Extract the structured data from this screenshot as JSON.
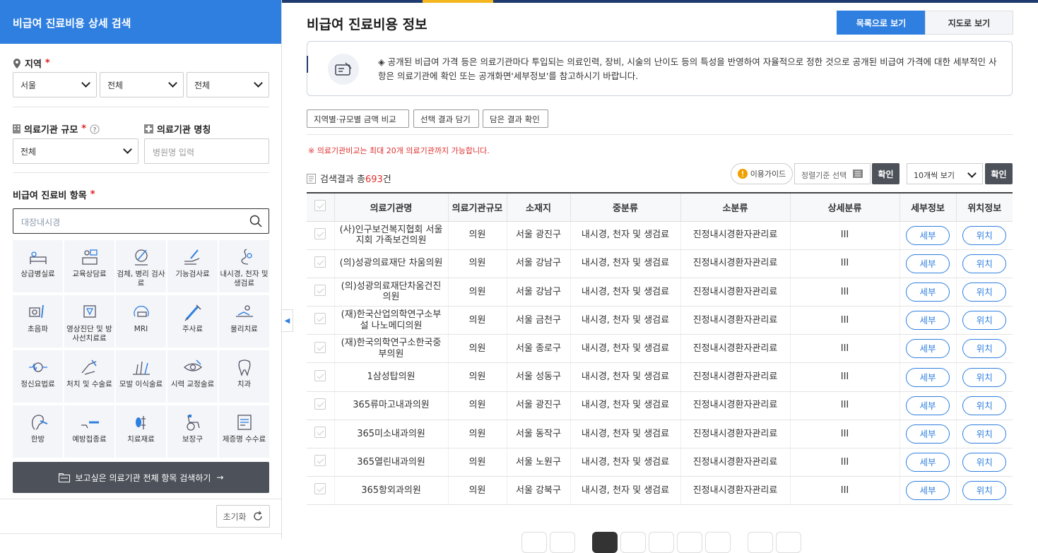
{
  "sidebar": {
    "title": "비급여 진료비용 상세 검색",
    "region_label": "지역",
    "required_mark": "*",
    "region_selects": [
      "서울",
      "전체",
      "전체"
    ],
    "scale_label": "의료기관 규모",
    "scale_select": "전체",
    "name_label": "의료기관 명칭",
    "name_placeholder": "병원명 입력",
    "items_label": "비급여 진료비 항목",
    "search_value": "대장내시경",
    "categories": [
      {
        "label": "상급병실료",
        "icon": "bed-icon"
      },
      {
        "label": "교육상담료",
        "icon": "consult-icon"
      },
      {
        "label": "검체, 병리 검사료",
        "icon": "microscope-icon"
      },
      {
        "label": "기능검사료",
        "icon": "hand-test-icon"
      },
      {
        "label": "내시경, 천자 및 생검료",
        "icon": "endoscope-icon"
      },
      {
        "label": "초음파",
        "icon": "ultrasound-icon"
      },
      {
        "label": "영상진단 및 방사선치료료",
        "icon": "scan-icon"
      },
      {
        "label": "MRI",
        "icon": "mri-icon"
      },
      {
        "label": "주사료",
        "icon": "syringe-icon"
      },
      {
        "label": "물리치료",
        "icon": "therapy-icon"
      },
      {
        "label": "정신요법료",
        "icon": "brain-icon"
      },
      {
        "label": "처치 및 수술료",
        "icon": "surgery-icon"
      },
      {
        "label": "모발 이식술료",
        "icon": "hair-icon"
      },
      {
        "label": "시력 교정술료",
        "icon": "eye-icon"
      },
      {
        "label": "치과",
        "icon": "tooth-icon"
      },
      {
        "label": "한방",
        "icon": "ear-acupuncture-icon"
      },
      {
        "label": "예방접종료",
        "icon": "vaccine-icon"
      },
      {
        "label": "치료재료",
        "icon": "material-icon"
      },
      {
        "label": "보장구",
        "icon": "wheelchair-icon"
      },
      {
        "label": "제증명 수수료",
        "icon": "certificate-icon"
      }
    ],
    "search_all_button": "보고싶은 의료기관 전체 항목 검색하기",
    "reset_button": "초기화"
  },
  "main": {
    "title": "비급여 진료비용 정보",
    "view_list": "목록으로 보기",
    "view_map": "지도로 보기",
    "notice": "◈ 공개된 비급여 가격 등은 의료기관마다 투입되는 의료인력, 장비, 시술의 난이도 등의 특성을 반영하여 자율적으로 정한 것으로 공개된 비급여 가격에 대한 세부적인 사항은 의료기관에 확인 또는 공개화면'세부정보'를 참고하시기 바랍니다.",
    "compare_button": "지역별·규모별 금액 비교",
    "select_button": "선택 결과 담기",
    "saved_button": "담은 결과 확인",
    "warning": "※ 의료기관비교는 최대 20개 의료기관까지 가능합니다.",
    "result_prefix": "검색결과 총",
    "result_count": "693",
    "result_suffix": "건",
    "guide_button": "이용가이드",
    "sort_select": "정렬기준 선택",
    "confirm_button": "확인",
    "page_size_select": "10개씩 보기",
    "columns": [
      "의료기관명",
      "의료기관규모",
      "소재지",
      "중분류",
      "소분류",
      "상세분류",
      "세부정보",
      "위치정보"
    ],
    "detail_label": "세부",
    "location_label": "위치",
    "rows": [
      {
        "name": "(사)인구보건복지협회 서울지회 가족보건의원",
        "scale": "의원",
        "loc": "서울 광진구",
        "mid": "내시경, 천자 및 생검료",
        "sub": "진정내시경환자관리료",
        "detail": "III"
      },
      {
        "name": "(의)성광의료재단 차움의원",
        "scale": "의원",
        "loc": "서울 강남구",
        "mid": "내시경, 천자 및 생검료",
        "sub": "진정내시경환자관리료",
        "detail": "III"
      },
      {
        "name": "(의)성광의료재단차움건진의원",
        "scale": "의원",
        "loc": "서울 강남구",
        "mid": "내시경, 천자 및 생검료",
        "sub": "진정내시경환자관리료",
        "detail": "III"
      },
      {
        "name": "(재)한국산업의학연구소부설 나노메디의원",
        "scale": "의원",
        "loc": "서울 금천구",
        "mid": "내시경, 천자 및 생검료",
        "sub": "진정내시경환자관리료",
        "detail": "III"
      },
      {
        "name": "(재)한국의학연구소한국중부의원",
        "scale": "의원",
        "loc": "서울 종로구",
        "mid": "내시경, 천자 및 생검료",
        "sub": "진정내시경환자관리료",
        "detail": "III"
      },
      {
        "name": "1삼성탑의원",
        "scale": "의원",
        "loc": "서울 성동구",
        "mid": "내시경, 천자 및 생검료",
        "sub": "진정내시경환자관리료",
        "detail": "III"
      },
      {
        "name": "365류마고내과의원",
        "scale": "의원",
        "loc": "서울 광진구",
        "mid": "내시경, 천자 및 생검료",
        "sub": "진정내시경환자관리료",
        "detail": "III"
      },
      {
        "name": "365미소내과의원",
        "scale": "의원",
        "loc": "서울 동작구",
        "mid": "내시경, 천자 및 생검료",
        "sub": "진정내시경환자관리료",
        "detail": "III"
      },
      {
        "name": "365열린내과의원",
        "scale": "의원",
        "loc": "서울 노원구",
        "mid": "내시경, 천자 및 생검료",
        "sub": "진정내시경환자관리료",
        "detail": "III"
      },
      {
        "name": "365항외과의원",
        "scale": "의원",
        "loc": "서울 강북구",
        "mid": "내시경, 천자 및 생검료",
        "sub": "진정내시경환자관리료",
        "detail": "III"
      }
    ]
  }
}
